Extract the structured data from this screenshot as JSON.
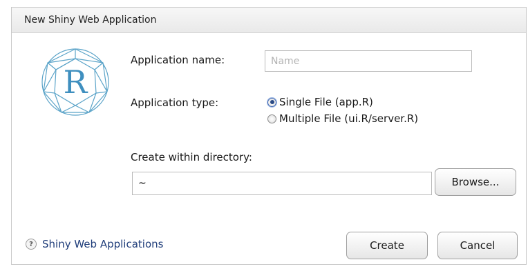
{
  "dialog": {
    "title": "New Shiny Web Application",
    "logo_letter": "R"
  },
  "form": {
    "app_name_label": "Application name:",
    "app_name_value": "",
    "app_name_placeholder": "Name",
    "app_type_label": "Application type:",
    "app_type_options": [
      {
        "label": "Single File (app.R)",
        "selected": true
      },
      {
        "label": "Multiple File (ui.R/server.R)",
        "selected": false
      }
    ],
    "directory_label": "Create within directory:",
    "directory_value": "~",
    "browse_label": "Browse..."
  },
  "footer": {
    "help_icon": "?",
    "help_link": "Shiny Web Applications",
    "create_label": "Create",
    "cancel_label": "Cancel"
  },
  "colors": {
    "logo_stroke": "#5aa3c8",
    "logo_letter": "#3f8fbf",
    "link": "#1f3d7a"
  }
}
